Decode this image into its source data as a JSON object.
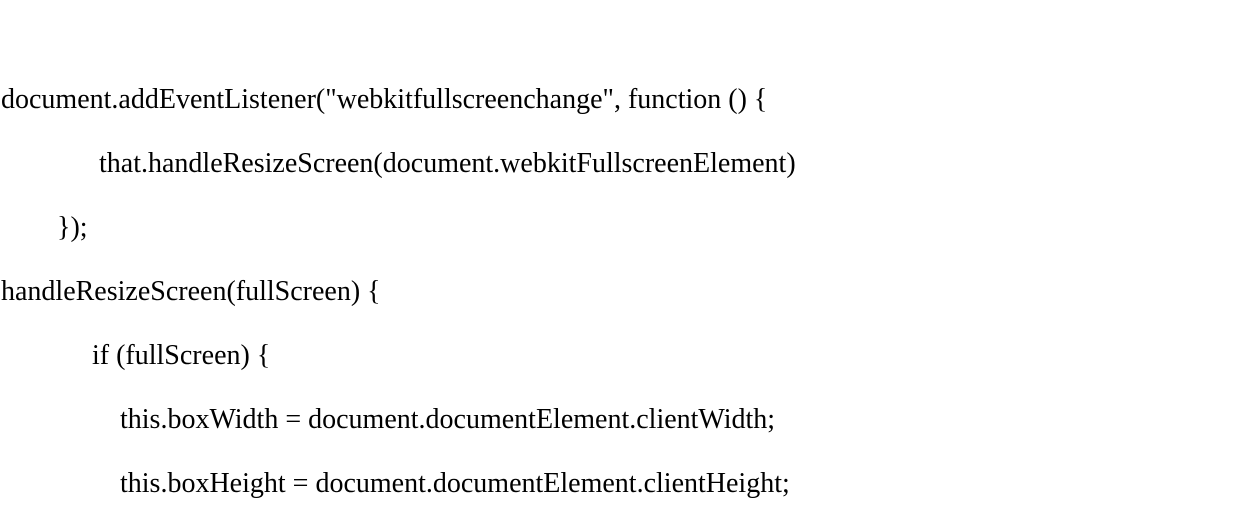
{
  "code": {
    "lines": [
      "document.addEventListener(\"webkitfullscreenchange\", function () {",
      "              that.handleResizeScreen(document.webkitFullscreenElement)",
      "        });",
      "handleResizeScreen(fullScreen) {",
      "             if (fullScreen) {",
      "                 this.boxWidth = document.documentElement.clientWidth;",
      "                 this.boxHeight = document.documentElement.clientHeight;"
    ]
  }
}
